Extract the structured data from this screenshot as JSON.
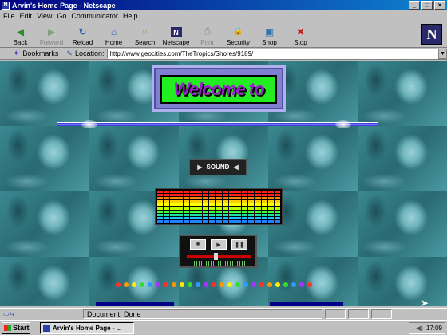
{
  "window": {
    "title": "Arvin's Home Page - Netscape",
    "min": "_",
    "max": "□",
    "close": "×"
  },
  "menu": [
    "File",
    "Edit",
    "View",
    "Go",
    "Communicator",
    "Help"
  ],
  "toolbar": [
    {
      "label": "Back",
      "icon": "back-arrow-icon",
      "glyph": "◀",
      "enabled": true
    },
    {
      "label": "Forward",
      "icon": "forward-arrow-icon",
      "glyph": "▶",
      "enabled": false
    },
    {
      "label": "Reload",
      "icon": "reload-icon",
      "glyph": "↻",
      "enabled": true
    },
    {
      "label": "Home",
      "icon": "home-icon",
      "glyph": "⌂",
      "enabled": true
    },
    {
      "label": "Search",
      "icon": "search-icon",
      "glyph": "⌕",
      "enabled": true
    },
    {
      "label": "Netscape",
      "icon": "netscape-icon",
      "glyph": "N",
      "enabled": true
    },
    {
      "label": "Print",
      "icon": "print-icon",
      "glyph": "⎙",
      "enabled": false
    },
    {
      "label": "Security",
      "icon": "lock-icon",
      "glyph": "🔒",
      "enabled": true
    },
    {
      "label": "Shop",
      "icon": "shop-icon",
      "glyph": "▣",
      "enabled": true
    },
    {
      "label": "Stop",
      "icon": "stop-icon",
      "glyph": "✖",
      "enabled": true
    }
  ],
  "location": {
    "bookmarks_label": "Bookmarks",
    "location_label": "Location:",
    "url": "http://www.geocities.com/TheTropics/Shores/9189/"
  },
  "page": {
    "welcome_text": "Welcome to",
    "sound_label": "SOUND"
  },
  "status": {
    "text": "Document: Done"
  },
  "taskbar": {
    "start_label": "Start",
    "task_item": "Arvin's Home Page - ...",
    "clock": "17:09"
  }
}
